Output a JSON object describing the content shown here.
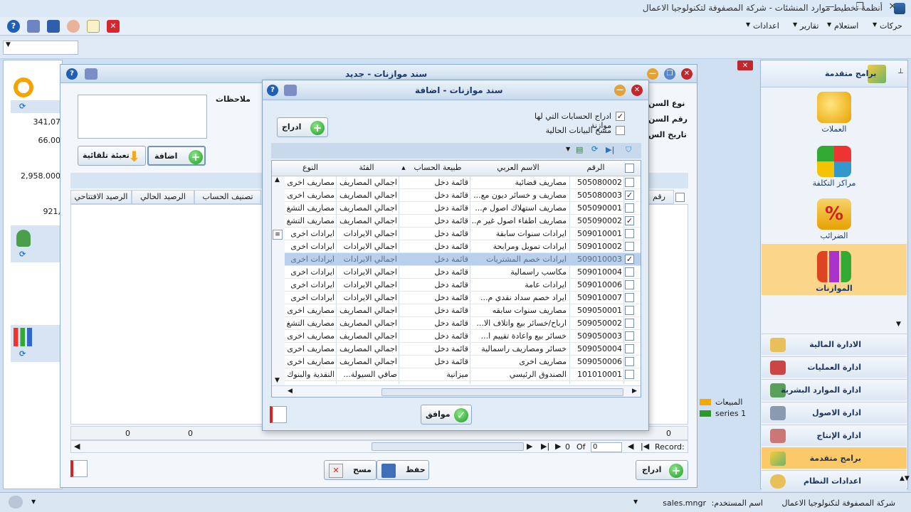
{
  "window": {
    "title": "أنظمة تخطيط موارد المنشئات - شركة المصفوفة لتكنولوجيا الاعمال"
  },
  "menu": {
    "items": [
      "حركات",
      "استعلام",
      "تقارير",
      "اعدادات"
    ]
  },
  "right_nav": {
    "header": "برامج متقدمة",
    "big_items": [
      "العملات",
      "مراكز التكلفة",
      "الضرائب",
      "الموازنات"
    ],
    "bars": [
      "الادارة المالية",
      "ادارة العمليات",
      "ادارة الموارد البشرية",
      "ادارة الاصول",
      "ادارة الإنتاج",
      "برامج متقدمة",
      "اعدادات النظام"
    ]
  },
  "left_strip": {
    "values": [
      "341,07",
      "66.00",
      "2,958.000",
      "921,"
    ]
  },
  "bg_window": {
    "title": "سند موازنات - جديد",
    "notes_label": "ملاحظات",
    "side_labels": [
      "نوع السن",
      "رقم السن",
      "تاريخ الس"
    ],
    "add_button": "اضافة",
    "autofill_button": "تعبئة تلقائية",
    "columns": [
      "الرصيد الافتتاحي",
      "الرصيد الحالي",
      "تصنيف الحساب"
    ],
    "right_col_label": "رقم",
    "totals": [
      "0",
      "0",
      "0"
    ],
    "record_label": "Record:",
    "record_value": "0",
    "of_label": "Of",
    "of_value": "0",
    "legend": [
      "المبيعات",
      "series 1"
    ],
    "insert_button": "ادراج",
    "save_button": "حفظ",
    "clear_button": "مسح"
  },
  "dialog": {
    "title": "سند موازنات - اضافة",
    "opt_include": "ادراج الحسابات التي لها موازنة",
    "opt_clear": "مسح البيانات الحالية",
    "insert_button": "ادراج",
    "ok_button": "موافق",
    "columns": {
      "number": "الرقم",
      "arabic_name": "الاسم العربي",
      "account_nature": "طبيعة الحساب",
      "category": "الفئة",
      "type": "النوع"
    },
    "rows": [
      {
        "checked": false,
        "number": "505080002",
        "name": "مصاريف قضائية",
        "nature": "قائمة دخل",
        "category": "اجمالي المصاريف",
        "type": "مصاريف اخرى"
      },
      {
        "checked": true,
        "number": "505080003",
        "name": "مصاريف و خسائر ديون مع...",
        "nature": "قائمة دخل",
        "category": "اجمالي المصاريف",
        "type": "مصاريف اخرى"
      },
      {
        "checked": false,
        "number": "505090001",
        "name": "مصاريف استهلاك اصول م...",
        "nature": "قائمة دخل",
        "category": "اجمالي المصاريف",
        "type": "مصاريف التشغ"
      },
      {
        "checked": true,
        "number": "505090002",
        "name": "مصاريف اطفاء اصول غير م...",
        "nature": "قائمة دخل",
        "category": "اجمالي المصاريف",
        "type": "مصاريف التشغ"
      },
      {
        "checked": false,
        "number": "509010001",
        "name": "ايرادات سنوات سابقة",
        "nature": "قائمة دخل",
        "category": "اجمالي الايرادات",
        "type": "ايرادات اخرى"
      },
      {
        "checked": false,
        "number": "509010002",
        "name": "ايرادات تمويل ومرابحة",
        "nature": "قائمة دخل",
        "category": "اجمالي الايرادات",
        "type": "ايرادات اخرى"
      },
      {
        "checked": true,
        "number": "509010003",
        "name": "ايرادات خصم المشتريات",
        "nature": "قائمة دخل",
        "category": "اجمالي الايرادات",
        "type": "ايرادات اخرى",
        "selected": true
      },
      {
        "checked": false,
        "number": "509010004",
        "name": "مكاسب راسمالية",
        "nature": "قائمة دخل",
        "category": "اجمالي الايرادات",
        "type": "ايرادات اخرى"
      },
      {
        "checked": false,
        "number": "509010006",
        "name": "ايرادات عامة",
        "nature": "قائمة دخل",
        "category": "اجمالي الايرادات",
        "type": "ايرادات اخرى"
      },
      {
        "checked": false,
        "number": "509010007",
        "name": "ايراد خصم سداد نقدي م...",
        "nature": "قائمة دخل",
        "category": "اجمالي الايرادات",
        "type": "ايرادات اخرى"
      },
      {
        "checked": false,
        "number": "509050001",
        "name": "مصاريف سنوات سابقه",
        "nature": "قائمة دخل",
        "category": "اجمالي المصاريف",
        "type": "مصاريف اخرى"
      },
      {
        "checked": false,
        "number": "509050002",
        "name": "ارباح/خسائر بيع واتلاف الا...",
        "nature": "قائمة دخل",
        "category": "اجمالي المصاريف",
        "type": "مصاريف التشغ"
      },
      {
        "checked": false,
        "number": "509050003",
        "name": "خسائر بيع واعادة تقييم ا...",
        "nature": "قائمة دخل",
        "category": "اجمالي المصاريف",
        "type": "مصاريف اخرى"
      },
      {
        "checked": false,
        "number": "509050004",
        "name": "خسائر ومصاريف راسمالية",
        "nature": "قائمة دخل",
        "category": "اجمالي المصاريف",
        "type": "مصاريف اخرى"
      },
      {
        "checked": false,
        "number": "509050006",
        "name": "مصاريف اخرى",
        "nature": "قائمة دخل",
        "category": "اجمالي المصاريف",
        "type": "مصاريف اخرى"
      },
      {
        "checked": false,
        "number": "101010001",
        "name": "الصندوق الرئيسي",
        "nature": "ميزانية",
        "category": "صافي السيولة...",
        "type": "النقدية والبنوك"
      }
    ]
  },
  "status": {
    "user_label": "اسم المستخدم:",
    "user_value": "sales.mngr",
    "company": "شركة المصفوفة لتكنولوجيا الاعمال"
  },
  "colors": {
    "accent": "#1d9a1d",
    "selected_nav": "#fbd58a",
    "close": "#c0282d"
  }
}
